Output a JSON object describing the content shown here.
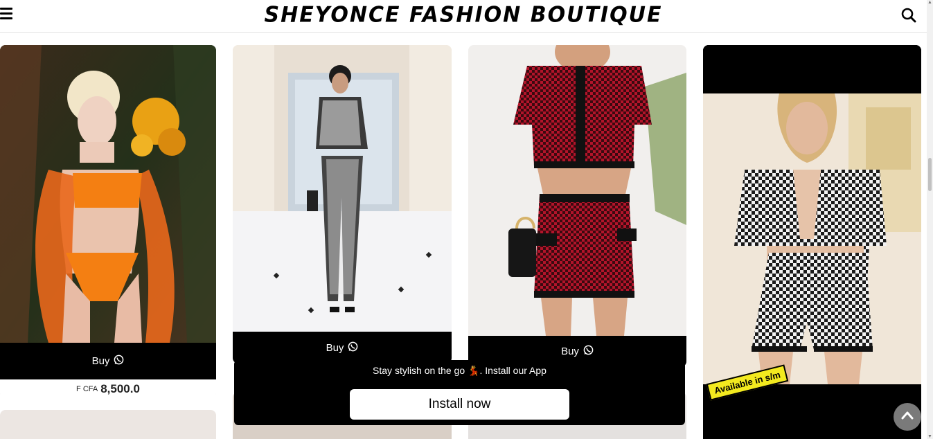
{
  "header": {
    "title": "SHEYONCE FASHION BOUTIQUE",
    "menu_icon": "hamburger-menu-icon",
    "search_icon": "search-icon"
  },
  "products": [
    {
      "buy_label": "Buy",
      "buy_icon": "whatsapp-icon",
      "price_currency": "F CFA",
      "price_value": "8,500.0"
    },
    {
      "buy_label": "Buy",
      "buy_icon": "whatsapp-icon"
    },
    {
      "buy_label": "Buy",
      "buy_icon": "whatsapp-icon"
    },
    {
      "badge": "Available in s/m"
    }
  ],
  "install_banner": {
    "message": "Stay stylish on the go 💃. Install our App",
    "button_label": "Install now"
  },
  "back_to_top_icon": "chevron-up-icon",
  "colors": {
    "bar": "#000000",
    "background": "#ffffff",
    "badge": "#f3ea1f"
  }
}
